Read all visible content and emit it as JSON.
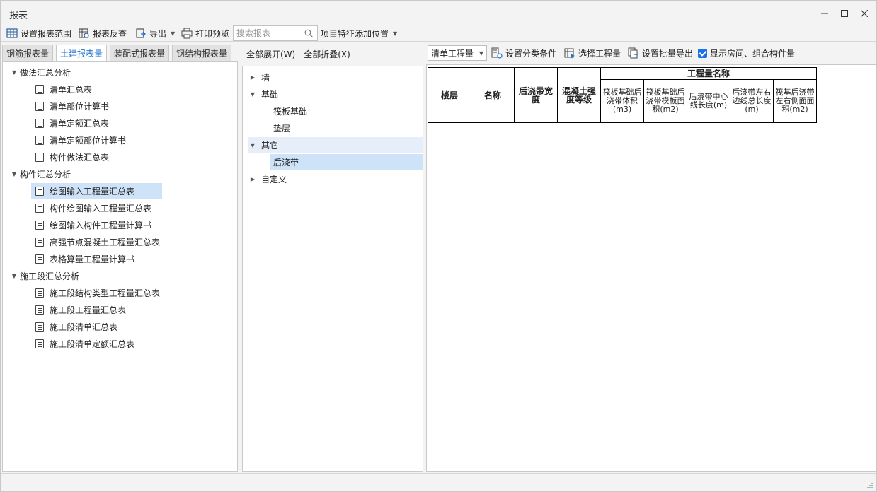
{
  "window": {
    "title": "报表"
  },
  "toolbar": {
    "set_range": "设置报表范围",
    "reverse_check": "报表反查",
    "export": "导出",
    "print_preview": "打印预览",
    "search_placeholder": "搜索报表",
    "feature_position": "项目特征添加位置"
  },
  "left_tabs": [
    "钢筋报表量",
    "土建报表量",
    "装配式报表量",
    "钢结构报表量"
  ],
  "left_tree": {
    "group1": {
      "label": "做法汇总分析",
      "items": [
        "清单汇总表",
        "清单部位计算书",
        "清单定额汇总表",
        "清单定额部位计算书",
        "构件做法汇总表"
      ]
    },
    "group2": {
      "label": "构件汇总分析",
      "items": [
        "绘图输入工程量汇总表",
        "构件绘图输入工程量汇总表",
        "绘图输入构件工程量计算书",
        "高强节点混凝土工程量汇总表",
        "表格算量工程量计算书"
      ]
    },
    "group3": {
      "label": "施工段汇总分析",
      "items": [
        "施工段结构类型工程量汇总表",
        "施工段工程量汇总表",
        "施工段清单汇总表",
        "施工段清单定额汇总表"
      ]
    }
  },
  "mid_toolbar": {
    "expand_all": "全部展开(W)",
    "collapse_all": "全部折叠(X)"
  },
  "mid_tree": {
    "wall": "墙",
    "foundation": "基础",
    "raft": "筏板基础",
    "cushion": "垫层",
    "other": "其它",
    "post_pour": "后浇带",
    "custom": "自定义"
  },
  "right_toolbar": {
    "combo_value": "清单工程量",
    "set_category": "设置分类条件",
    "select_quantity": "选择工程量",
    "batch_export": "设置批量导出",
    "show_rooms": "显示房间、组合构件量"
  },
  "report_table": {
    "floor": "楼层",
    "name": "名称",
    "width": "后浇带宽度",
    "concrete": "混凝土强度等级",
    "quantity_group": "工程量名称",
    "cols": [
      "筏板基础后浇带体积(m3)",
      "筏板基础后浇带模板面积(m2)",
      "后浇带中心线长度(m)",
      "后浇带左右边线总长度(m)",
      "筏基后浇带左右侧面面积(m2)"
    ]
  }
}
